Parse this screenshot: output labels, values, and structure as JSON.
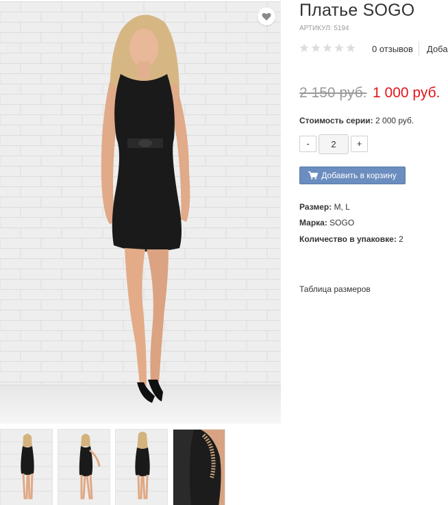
{
  "product": {
    "title": "Платье SOGO",
    "sku": "АРТИКУЛ: 5194",
    "rating": 0,
    "rating_max": 5,
    "reviews_label": "0 отзывов",
    "add_review_label": "Добавить отзыв",
    "old_price": "2 150 руб.",
    "new_price": "1 000 руб.",
    "series_label": "Стоимость серии:",
    "series_value": "2 000 руб.",
    "qty_minus": "-",
    "qty_plus": "+",
    "qty_value": "2",
    "cart_button": "Добавить в корзину",
    "attributes": {
      "size_label": "Размер:",
      "size_value": "M, L",
      "brand_label": "Марка:",
      "brand_value": "SOGO",
      "pack_label": "Количество в упаковке:",
      "pack_value": "2"
    },
    "size_table_link": "Таблица размеров"
  },
  "gallery": {
    "main_image": "woman-black-dress-photo",
    "wishlist_icon": "heart-icon",
    "thumbnails": [
      "dress-front-thumb",
      "dress-angle-thumb",
      "dress-back-thumb",
      "dress-lace-detail-thumb"
    ]
  },
  "colors": {
    "price_red": "#e0151b",
    "cart_button": "#6b8dbf",
    "star_empty": "#dddddd"
  }
}
